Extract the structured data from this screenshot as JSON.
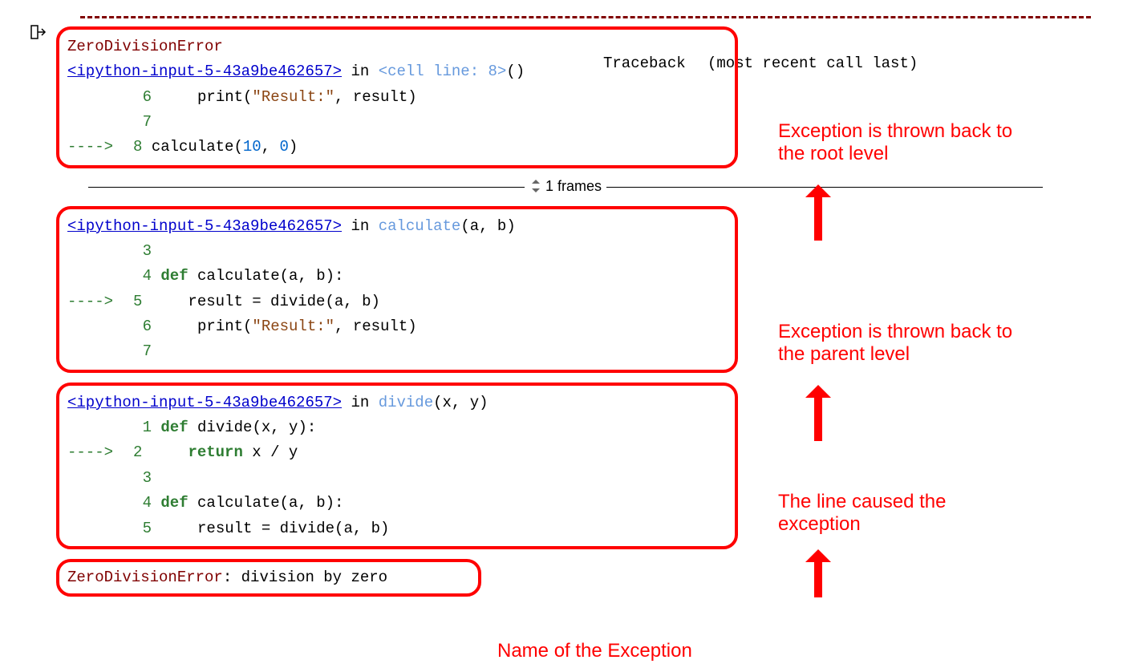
{
  "exception": {
    "name": "ZeroDivisionError",
    "traceback_label": "Traceback",
    "recent_text": "(most recent call last)",
    "final_message": "division by zero"
  },
  "frames_sep": "1 frames",
  "source_link": "<ipython-input-5-43a9be462657>",
  "frame1": {
    "in_text": "in",
    "cell_line": "<cell line: 8>",
    "suffix": "()",
    "lines": [
      {
        "n": "6",
        "prefix": "     ",
        "code": "    print(\"Result:\", result)"
      },
      {
        "n": "7",
        "prefix": "     ",
        "code": ""
      },
      {
        "n": "8",
        "prefix": "---->",
        "code": "calculate(10, 0)",
        "is_call": true
      }
    ]
  },
  "frame2": {
    "in_text": "in",
    "fn": "calculate",
    "args": "(a, b)",
    "lines": [
      {
        "n": "3",
        "prefix": "     ",
        "code": ""
      },
      {
        "n": "4",
        "prefix": "     ",
        "code": "def calculate(a, b):"
      },
      {
        "n": "5",
        "prefix": "---->",
        "code": "    result = divide(a, b)"
      },
      {
        "n": "6",
        "prefix": "     ",
        "code": "    print(\"Result:\", result)"
      },
      {
        "n": "7",
        "prefix": "     ",
        "code": ""
      }
    ]
  },
  "frame3": {
    "in_text": "in",
    "fn": "divide",
    "args": "(x, y)",
    "lines": [
      {
        "n": "1",
        "prefix": "     ",
        "code": "def divide(x, y):"
      },
      {
        "n": "2",
        "prefix": "---->",
        "code": "    return x / y"
      },
      {
        "n": "3",
        "prefix": "     ",
        "code": ""
      },
      {
        "n": "4",
        "prefix": "     ",
        "code": "def calculate(a, b):"
      },
      {
        "n": "5",
        "prefix": "     ",
        "code": "    result = divide(a, b)"
      }
    ]
  },
  "annotations": {
    "root": "Exception is thrown back to the root level",
    "parent": "Exception is thrown back to the parent level",
    "line": "The line caused the exception",
    "name": "Name of the Exception"
  }
}
